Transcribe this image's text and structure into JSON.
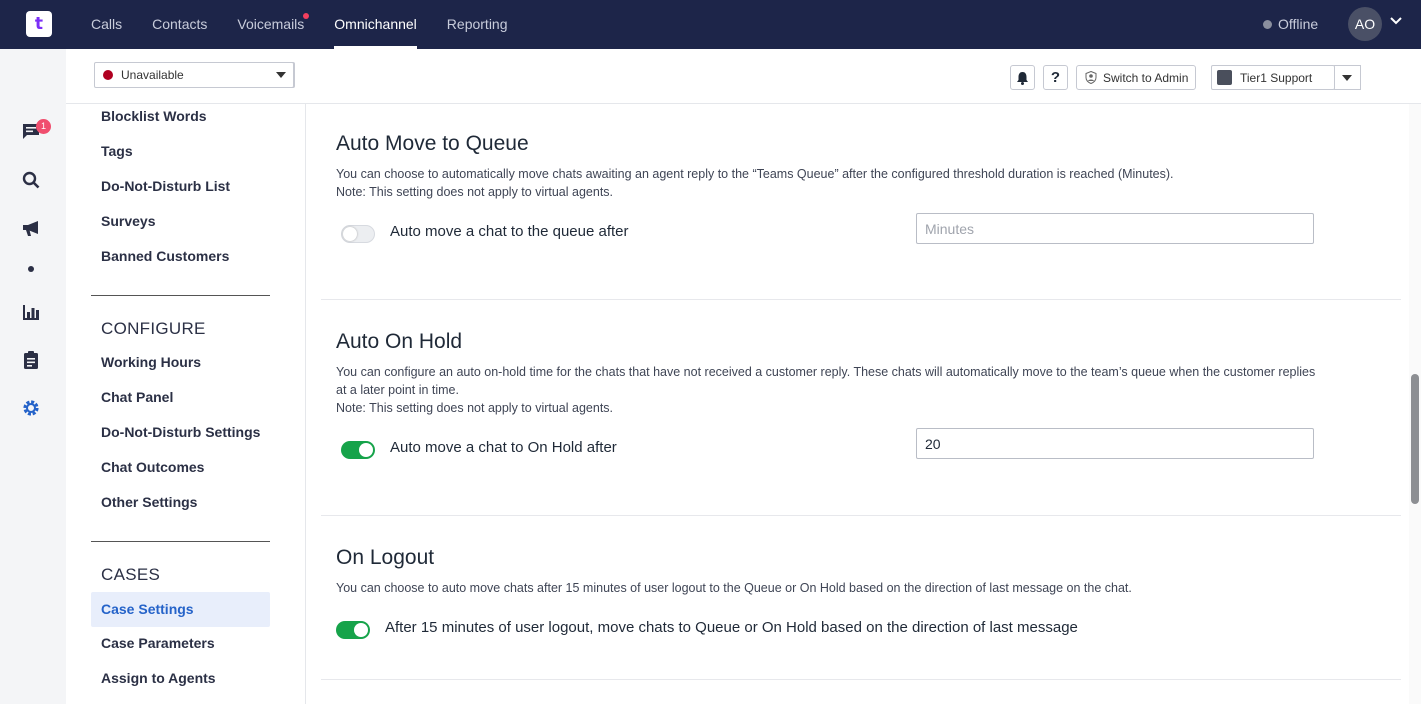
{
  "topnav": {
    "logo": "t",
    "items": [
      {
        "label": "Calls",
        "active": false,
        "dot": false
      },
      {
        "label": "Contacts",
        "active": false,
        "dot": false
      },
      {
        "label": "Voicemails",
        "active": false,
        "dot": true
      },
      {
        "label": "Omnichannel",
        "active": true,
        "dot": false
      },
      {
        "label": "Reporting",
        "active": false,
        "dot": false
      }
    ],
    "presence": "Offline",
    "avatar_initials": "AO"
  },
  "rail": {
    "icons": [
      "chat-icon",
      "search-icon",
      "megaphone-icon",
      "dot-icon",
      "bar-chart-icon",
      "clipboard-icon",
      "gear-icon"
    ],
    "chat_badge": "1"
  },
  "subheader": {
    "status_value": "Unavailable",
    "bell_icon": "bell-icon",
    "help_label": "?",
    "switch_admin_label": "Switch to Admin",
    "team_value": "Tier1 Support"
  },
  "menu": {
    "group_top": [
      "Blocklist Words",
      "Tags",
      "Do-Not-Disturb List",
      "Surveys",
      "Banned Customers"
    ],
    "configure_heading": "CONFIGURE",
    "configure": [
      "Working Hours",
      "Chat Panel",
      "Do-Not-Disturb Settings",
      "Chat Outcomes",
      "Other Settings"
    ],
    "cases_heading": "CASES",
    "cases": [
      "Case Settings",
      "Case Parameters",
      "Assign to Agents"
    ],
    "active_item": "Case Settings"
  },
  "sections": {
    "auto_move": {
      "title": "Auto Move to Queue",
      "desc_1": "You can choose to automatically move chats awaiting an agent reply to the “Teams Queue” after the configured threshold duration is reached (Minutes).",
      "desc_2": "Note: This setting does not apply to virtual agents.",
      "toggle_label": "Auto move a chat to the queue after",
      "toggle_on": false,
      "input_value": "",
      "input_placeholder": "Minutes"
    },
    "auto_hold": {
      "title": "Auto On Hold",
      "desc_1": "You can configure an auto on-hold time for the chats that have not received a customer reply. These chats will automatically move to the team’s queue when the customer replies at a later point in time.",
      "desc_2": "Note: This setting does not apply to virtual agents.",
      "toggle_label": "Auto move a chat to On Hold after",
      "toggle_on": true,
      "input_value": "20"
    },
    "on_logout": {
      "title": "On Logout",
      "desc_1": "You can choose to auto move chats after 15 minutes of user logout to the Queue or On Hold based on the direction of last message on the chat.",
      "toggle_label": "After 15 minutes of user logout, move chats to Queue or On Hold based on the direction of last message",
      "toggle_on": true
    }
  },
  "colors": {
    "nav_bg": "#1d2549",
    "accent_blue": "#2563c9",
    "toggle_on": "#16a34a",
    "badge": "#f04e6e"
  }
}
